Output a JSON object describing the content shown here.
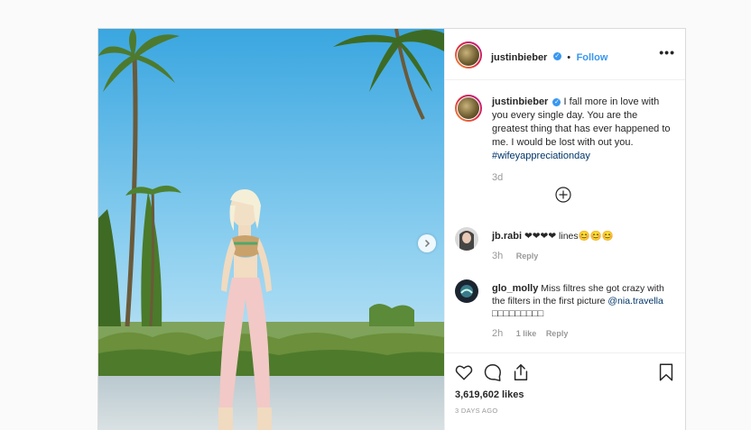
{
  "post": {
    "username": "justinbieber",
    "follow_label": "Follow",
    "dot": "•",
    "more_label": "•••",
    "caption_text": "I fall more in love with you every single day. You are the greatest thing that has ever happened to me. I would be lost with out you.",
    "caption_hashtag": "#wifeyappreciationday",
    "caption_time": "3d"
  },
  "comments": [
    {
      "username": "jb.rabi",
      "text": "❤❤❤❤ lines😊😊😊",
      "time": "3h",
      "likes": "",
      "reply_label": "Reply"
    },
    {
      "username": "glo_molly",
      "text": "Miss filtres she got crazy with the filters in the first picture",
      "mention": "@nia.travella",
      "tail": "□□□□□□□□□",
      "time": "2h",
      "likes": "1 like",
      "reply_label": "Reply"
    }
  ],
  "stats": {
    "likes": "3,619,602 likes",
    "date": "3 DAYS AGO"
  },
  "icons": [
    "heart-icon",
    "comment-icon",
    "share-icon",
    "bookmark-icon",
    "plus-circle-icon",
    "chevron-right-icon",
    "verified-icon",
    "more-icon"
  ],
  "colors": {
    "accent": "#3897f0",
    "link": "#003569",
    "muted": "#999999",
    "border": "#dbdbdb"
  }
}
